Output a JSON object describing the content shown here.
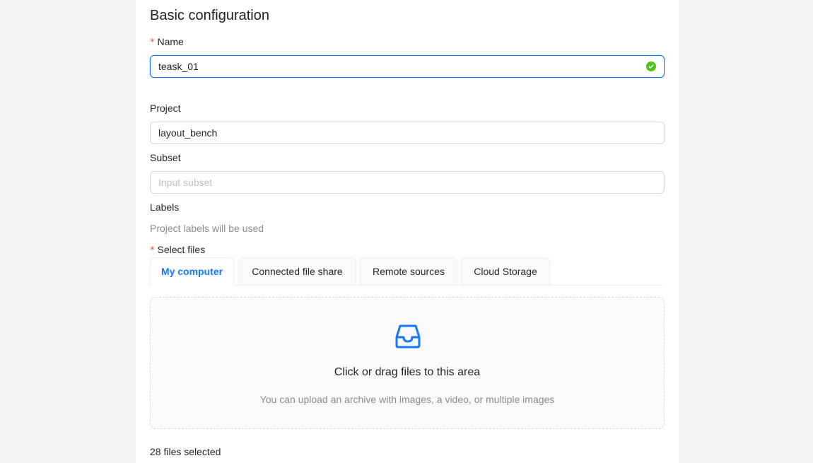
{
  "section": {
    "title": "Basic configuration"
  },
  "name_field": {
    "label": "Name",
    "required_mark": "*",
    "value": "teask_01",
    "status": "valid"
  },
  "project_field": {
    "label": "Project",
    "value": "layout_bench"
  },
  "subset_field": {
    "label": "Subset",
    "value": "",
    "placeholder": "Input subset"
  },
  "labels_field": {
    "label": "Labels",
    "hint": "Project labels will be used"
  },
  "files": {
    "label": "Select files",
    "required_mark": "*",
    "tabs": [
      {
        "label": "My computer",
        "active": true
      },
      {
        "label": "Connected file share",
        "active": false
      },
      {
        "label": "Remote sources",
        "active": false
      },
      {
        "label": "Cloud Storage",
        "active": false
      }
    ],
    "dropzone": {
      "icon": "inbox-icon",
      "title": "Click or drag files to this area",
      "hint": "You can upload an archive with images, a video, or multiple images"
    },
    "selected_count_text": "28 files selected"
  },
  "colors": {
    "accent": "#1677ff",
    "success": "#52c41a",
    "required": "#ff4d4f",
    "page_bg": "#f2f2f2"
  }
}
